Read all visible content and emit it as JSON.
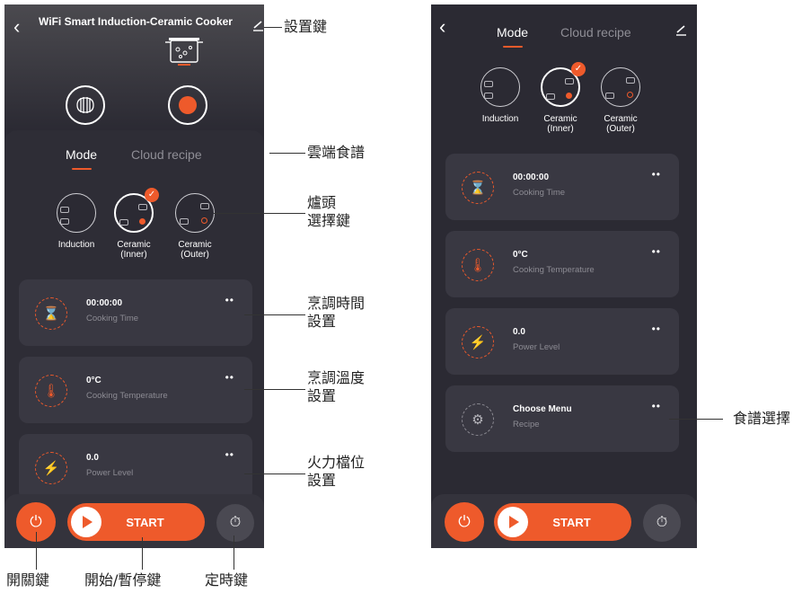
{
  "phone1": {
    "back_icon": "chevron-left-icon",
    "title": "WiFi Smart Induction-Ceramic Cooker",
    "edit_icon": "pencil-icon",
    "tabs": [
      {
        "label": "Mode"
      },
      {
        "label": "Cloud recipe"
      }
    ],
    "burners": [
      {
        "label_line1": "Induction",
        "label_line2": ""
      },
      {
        "label_line1": "Ceramic",
        "label_line2": "(Inner)"
      },
      {
        "label_line1": "Ceramic",
        "label_line2": "(Outer)"
      }
    ],
    "cards": [
      {
        "value": "00:00:00",
        "label": "Cooking Time",
        "icon": "hourglass-icon",
        "more": "••"
      },
      {
        "value": "0°C",
        "label": "Cooking Temperature",
        "icon": "thermometer-icon",
        "more": "••"
      },
      {
        "value": "0.0",
        "label": "Power Level",
        "icon": "lightning-icon",
        "more": "••"
      }
    ],
    "start_label": "START"
  },
  "phone2": {
    "tabs": [
      {
        "label": "Mode"
      },
      {
        "label": "Cloud recipe"
      }
    ],
    "burners": [
      {
        "label_line1": "Induction",
        "label_line2": ""
      },
      {
        "label_line1": "Ceramic",
        "label_line2": "(Inner)"
      },
      {
        "label_line1": "Ceramic",
        "label_line2": "(Outer)"
      }
    ],
    "cards": [
      {
        "value": "00:00:00",
        "label": "Cooking Time",
        "icon": "hourglass-icon",
        "more": "••"
      },
      {
        "value": "0°C",
        "label": "Cooking Temperature",
        "icon": "thermometer-icon",
        "more": "••"
      },
      {
        "value": "0.0",
        "label": "Power Level",
        "icon": "lightning-icon",
        "more": "••"
      },
      {
        "value": "Choose Menu",
        "label": "Recipe",
        "icon": "gear-icon",
        "more": "••"
      }
    ],
    "start_label": "START"
  },
  "callouts": {
    "settings_key": "設置鍵",
    "cloud_recipe": "雲端食譜",
    "burner_select_1": "爐頭",
    "burner_select_2": "選擇鍵",
    "time_setting_1": "烹調時間",
    "time_setting_2": "設置",
    "temp_setting_1": "烹調溫度",
    "temp_setting_2": "設置",
    "power_setting_1": "火力檔位",
    "power_setting_2": "設置",
    "recipe_select": "食譜選擇",
    "power_key": "開關鍵",
    "start_pause_key": "開始/暫停鍵",
    "timer_key": "定時鍵"
  },
  "colors": {
    "accent": "#ee5a2b",
    "background": "#2b2a33",
    "card": "#393842"
  }
}
